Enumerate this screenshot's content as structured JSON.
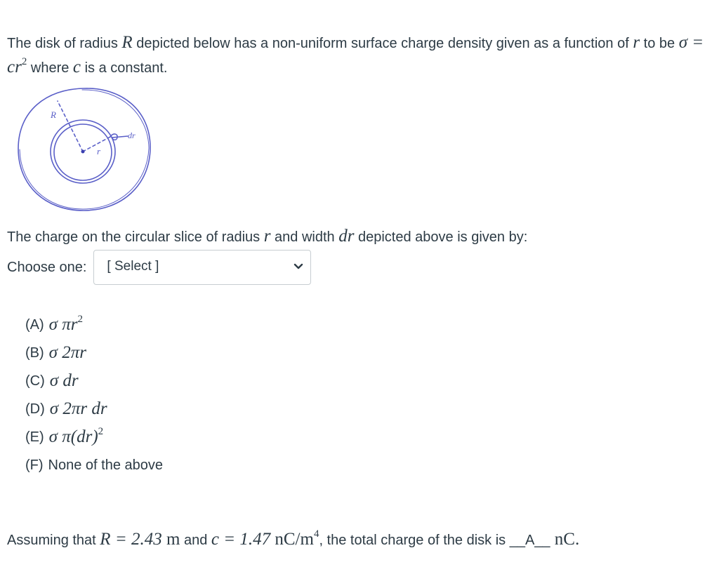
{
  "intro": {
    "text1": "The disk of radius ",
    "var_R": "R",
    "text2": " depicted below has a non-uniform surface charge density given as a function of ",
    "var_r": "r",
    "text3": " to be ",
    "formula_sigma": "σ = cr",
    "formula_exp": "2",
    "text4": " where ",
    "var_c": "c",
    "text5": " is a constant."
  },
  "diagram": {
    "label_R": "R",
    "label_r": "r",
    "label_dr": "dr",
    "ink_color": "#5a5fc8"
  },
  "question": {
    "text1": "The charge on the circular slice of radius ",
    "var_r": "r",
    "text2": " and width ",
    "var_dr": "dr",
    "text3": " depicted above is given by:"
  },
  "choose": {
    "label": "Choose one:",
    "selected": "[ Select ]"
  },
  "options": [
    {
      "letter": "(A)",
      "expr": "σ πr",
      "exp": "2"
    },
    {
      "letter": "(B)",
      "expr": "σ 2πr",
      "exp": ""
    },
    {
      "letter": "(C)",
      "expr": "σ dr",
      "exp": ""
    },
    {
      "letter": "(D)",
      "expr": "σ 2πr dr",
      "exp": ""
    },
    {
      "letter": "(E)",
      "expr": "σ π(dr)",
      "exp": "2"
    },
    {
      "letter": "(F)",
      "text": "None of the above"
    }
  ],
  "final": {
    "text1": "Assuming that ",
    "eq_R": "R = 2.43",
    "unit_m": " m",
    "text2": " and ",
    "eq_c": "c = 1.47",
    "unit_c": " nC/m",
    "unit_exp": "4",
    "text3": ", the total charge of the disk is ",
    "blank": "__A__",
    "unit_nC": " nC."
  }
}
